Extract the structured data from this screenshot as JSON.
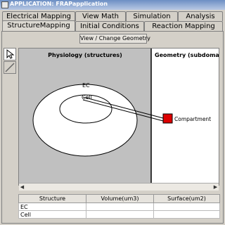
{
  "window": {
    "title": "APPLICATION: FRAPapplication"
  },
  "tabs_back": [
    {
      "label": "Electrical Mapping"
    },
    {
      "label": "View Math"
    },
    {
      "label": "Simulation"
    },
    {
      "label": "Analysis"
    }
  ],
  "tabs_front": [
    {
      "label": "StructureMapping"
    },
    {
      "label": "Initial Conditions"
    },
    {
      "label": "Reaction Mapping"
    }
  ],
  "toolbar": {
    "view_change_label": "View / Change Geometry"
  },
  "tools": [
    {
      "icon": "pointer-icon"
    },
    {
      "icon": "line-icon"
    }
  ],
  "canvas": {
    "physiology_header": "Physiology (structures)",
    "geometry_header": "Geometry (subdomain",
    "ec_label": "EC",
    "cell_label": "Cell",
    "compartment_label": "Compartment"
  },
  "table": {
    "headers": [
      "Structure",
      "Volume(um3)",
      "Surface(um2)"
    ],
    "rows": [
      {
        "structure": "EC",
        "volume": "",
        "surface": ""
      },
      {
        "structure": "Cell",
        "volume": "",
        "surface": ""
      }
    ]
  },
  "colors": {
    "compartment": "#dd0000",
    "physiology_bg": "#c0c0c0",
    "titlebar": "#6c8fc4"
  }
}
